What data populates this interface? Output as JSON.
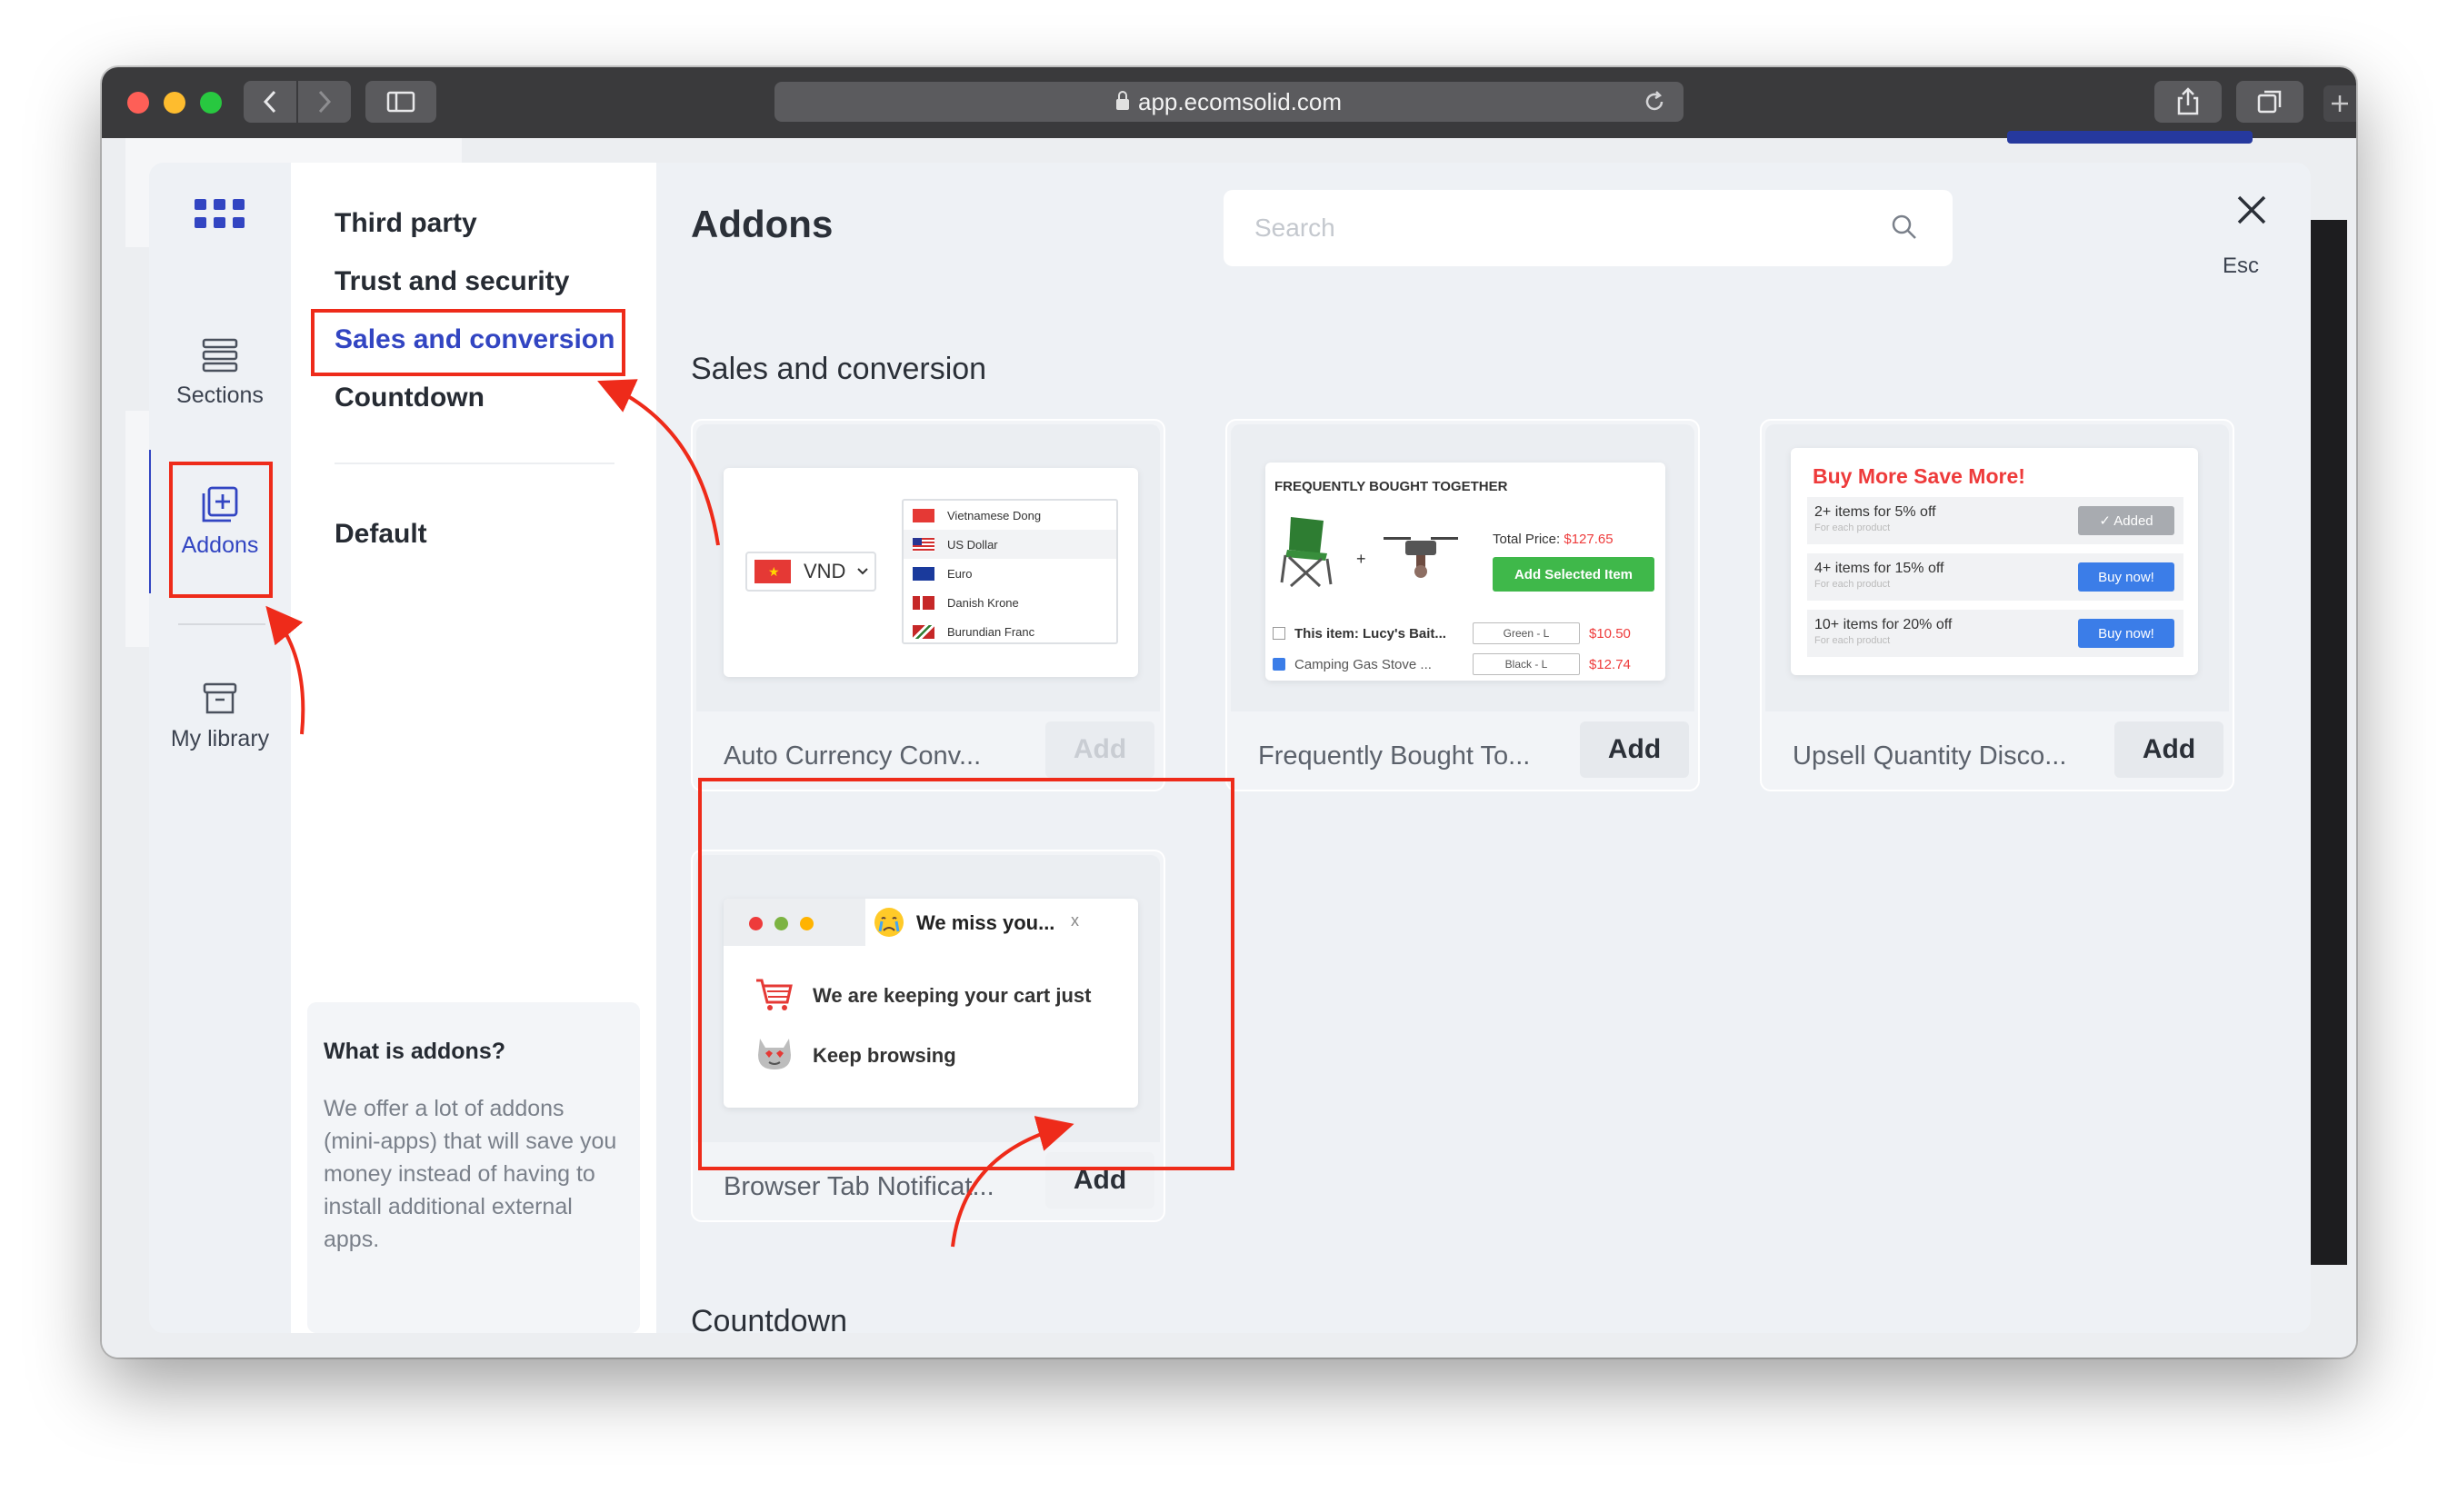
{
  "browser": {
    "url": "app.ecomsolid.com"
  },
  "rail": {
    "sections": "Sections",
    "addons": "Addons",
    "library": "My library"
  },
  "categories": {
    "third_party": "Third party",
    "trust": "Trust and security",
    "sales": "Sales and conversion",
    "countdown": "Countdown",
    "default": "Default"
  },
  "help": {
    "title": "What is addons?",
    "text": "We offer a lot of addons (mini-apps) that will save you money instead of having to install additional external apps."
  },
  "main": {
    "title": "Addons",
    "search_placeholder": "Search",
    "esc": "Esc",
    "section_sales": "Sales and conversion",
    "section_countdown": "Countdown"
  },
  "cards": [
    {
      "title": "Auto Currency Conv...",
      "button": "Add",
      "disabled": true
    },
    {
      "title": "Frequently Bought To...",
      "button": "Add",
      "disabled": false
    },
    {
      "title": "Upsell Quantity Disco...",
      "button": "Add",
      "disabled": false
    },
    {
      "title": "Browser Tab Notificat...",
      "button": "Add",
      "disabled": false
    }
  ],
  "currency_thumb": {
    "selected": "VND",
    "options": [
      "Vietnamese Dong",
      "US Dollar",
      "Euro",
      "Danish Krone",
      "Burundian Franc"
    ]
  },
  "fbt_thumb": {
    "heading": "FREQUENTLY BOUGHT TOGETHER",
    "total_label": "Total Price:",
    "total_value": "$127.65",
    "button": "Add Selected Item",
    "row1_label": "This item: Lucy's Bait...",
    "row1_variant": "Green - L",
    "row1_price": "$10.50",
    "row2_label": "Camping Gas Stove ...",
    "row2_variant": "Black - L",
    "row2_price": "$12.74"
  },
  "upsell_thumb": {
    "heading": "Buy More Save More!",
    "sub": "For each product",
    "rows": [
      {
        "label": "2+ items for 5% off",
        "button": "✓ Added"
      },
      {
        "label": "4+ items for 15% off",
        "button": "Buy now!"
      },
      {
        "label": "10+ items for 20% off",
        "button": "Buy now!"
      }
    ]
  },
  "tab_thumb": {
    "tab_title": "We miss you...",
    "tab_close": "x",
    "line1": "We are keeping your cart just",
    "line2": "Keep browsing"
  },
  "colors": {
    "accent": "#3245c2",
    "annotation": "#ee2b1a",
    "chat": "#6b2ee6",
    "fbt_button": "#3fb84a",
    "upsell_heading": "#ee3b3b",
    "upsell_button": "#3b7de8"
  }
}
